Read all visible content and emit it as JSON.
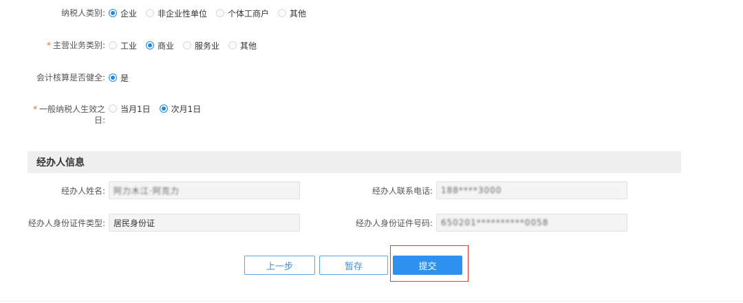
{
  "taxpayer_type": {
    "label": "纳税人类别:",
    "options": [
      "企业",
      "非企业性单位",
      "个体工商户",
      "其他"
    ],
    "selected": "企业"
  },
  "main_business": {
    "required_mark": "*",
    "label": "主营业务类别:",
    "options": [
      "工业",
      "商业",
      "服务业",
      "其他"
    ],
    "selected": "商业"
  },
  "accounting": {
    "label": "会计核算是否健全:",
    "options": [
      "是"
    ],
    "selected": "是"
  },
  "effective_date": {
    "required_mark": "*",
    "label_line1": "一般纳税人生效之",
    "label_line2": "日:",
    "options": [
      "当月1日",
      "次月1日"
    ],
    "selected": "次月1日"
  },
  "agent_section": {
    "title": "经办人信息",
    "name_label": "经办人姓名:",
    "name_value": "阿力木江·阿克力",
    "phone_label": "经办人联系电话:",
    "phone_value": "188****3000",
    "id_type_label": "经办人身份证件类型:",
    "id_type_value": "居民身份证",
    "id_number_label": "经办人身份证件号码:",
    "id_number_value": "650201**********0058"
  },
  "buttons": {
    "prev": "上一步",
    "save": "暂存",
    "submit": "提交"
  },
  "colors": {
    "primary": "#2e91ef",
    "required": "#ff6a00",
    "highlight": "#e53935"
  }
}
